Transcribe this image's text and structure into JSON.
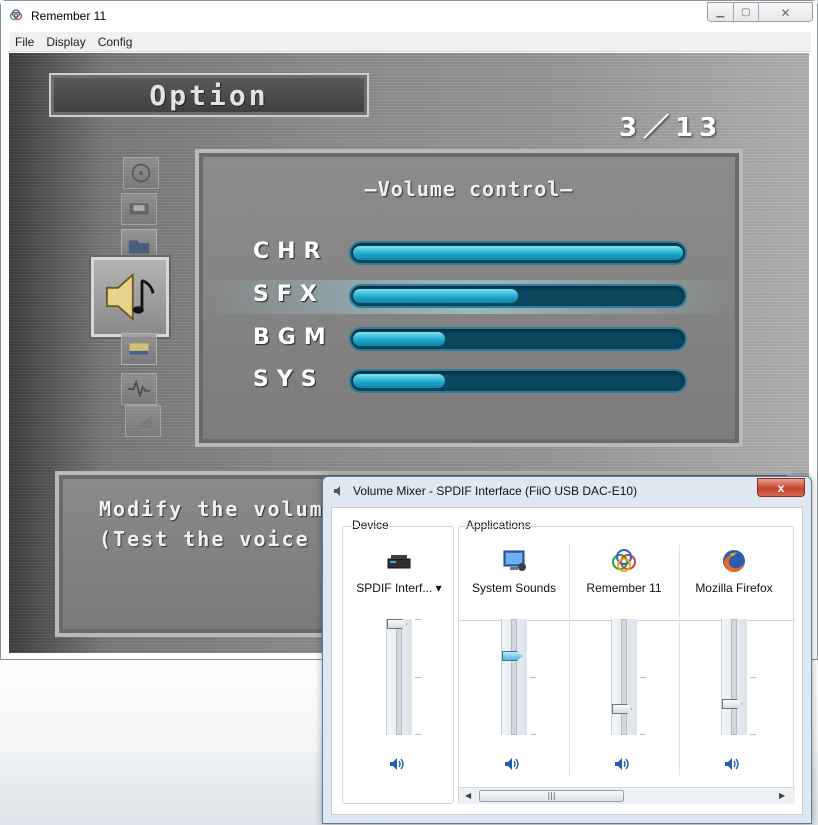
{
  "main_window": {
    "title": "Remember 11",
    "menu": [
      "File",
      "Display",
      "Config"
    ]
  },
  "game": {
    "option_title": "Option",
    "page": "3／13",
    "panel_title": "—Volume control—",
    "volumes": [
      {
        "label": "CHR",
        "level": 1.0
      },
      {
        "label": "SFX",
        "level": 0.5
      },
      {
        "label": "BGM",
        "level": 0.28
      },
      {
        "label": "SYS",
        "level": 0.28
      }
    ],
    "selected_row": "SFX",
    "message_lines": [
      "Modify the volume c",
      "(Test the voice and"
    ]
  },
  "mixer": {
    "title": "Volume Mixer - SPDIF Interface (FiiO USB DAC-E10)",
    "close_label": "x",
    "device_label": "Device",
    "applications_label": "Applications",
    "device": {
      "name": "SPDIF Interf...",
      "level": 1.0,
      "icon": "sound-card-icon"
    },
    "apps": [
      {
        "name": "System Sounds",
        "level": 0.7,
        "icon": "system-sounds-icon"
      },
      {
        "name": "Remember 11",
        "level": 0.2,
        "icon": "rings-icon"
      },
      {
        "name": "Mozilla Firefox",
        "level": 0.25,
        "icon": "firefox-icon"
      }
    ],
    "scroll_grip": "|||",
    "colors": {
      "active_thumb": "#52b7de",
      "speaker": "#1e5fb0"
    }
  }
}
